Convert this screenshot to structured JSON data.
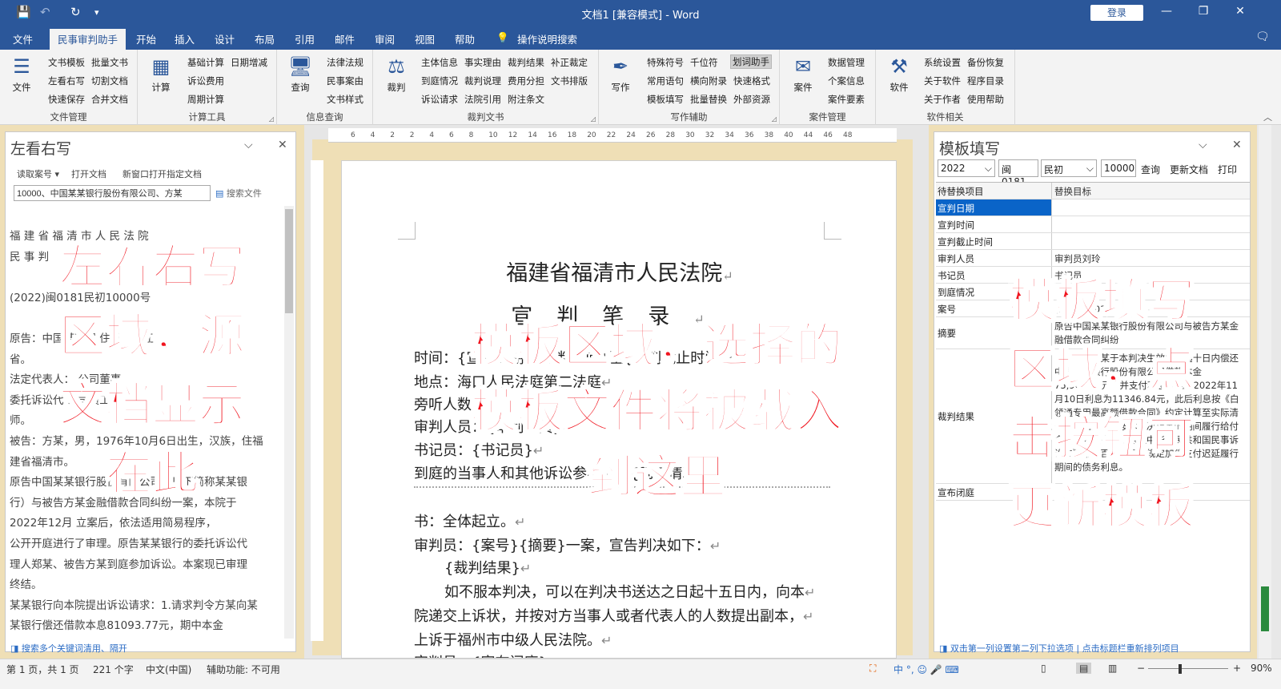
{
  "titlebar": {
    "doc_title": "文档1 [兼容模式] - Word",
    "login": "登录"
  },
  "tabs": [
    "文件",
    "民事审判助手",
    "开始",
    "插入",
    "设计",
    "布局",
    "引用",
    "邮件",
    "审阅",
    "视图",
    "帮助",
    "操作说明搜索"
  ],
  "ribbon": {
    "file": {
      "label": "文件",
      "items": [
        "文书模板",
        "批量文书",
        "左看右写",
        "切割文档",
        "快速保存",
        "合并文档"
      ],
      "group": "文件管理"
    },
    "calc": {
      "label": "计算",
      "items": [
        "基础计算",
        "日期增减",
        "诉讼费用",
        "周期计算"
      ],
      "group": "计算工具"
    },
    "query": {
      "label": "查询",
      "items": [
        "法律法规",
        "民事案由",
        "文书样式"
      ],
      "group": "信息查询"
    },
    "judge": {
      "label": "裁判",
      "items": [
        "主体信息",
        "事实理由",
        "裁判结果",
        "补正裁定",
        "到庭情况",
        "裁判说理",
        "费用分担",
        "文书排版",
        "诉讼请求",
        "法院引用",
        "附注条文"
      ],
      "group": "裁判文书"
    },
    "write": {
      "label": "写作",
      "items": [
        "特殊符号",
        "千位符",
        "划词助手",
        "常用语句",
        "横向附录",
        "快速格式",
        "模板填写",
        "批量替换",
        "外部资源"
      ],
      "group": "写作辅助"
    },
    "case": {
      "label": "案件",
      "items": [
        "数据管理",
        "个案信息",
        "案件要素"
      ],
      "group": "案件管理"
    },
    "soft": {
      "label": "软件",
      "items": [
        "系统设置",
        "备份恢复",
        "关于软件",
        "程序目录",
        "关于作者",
        "使用帮助"
      ],
      "group": "软件相关"
    }
  },
  "left": {
    "title": "左看右写",
    "tools": [
      "读取案号 ▾",
      "打开文档",
      "新窗口打开指定文档"
    ],
    "search_value": "10000、中国某某银行股份有限公司、方某",
    "search_btn": "搜索文件",
    "lines": [
      "福 建 省 福 清 市 人 民 法 院",
      "民 事 判",
      "",
      "(2022)闽0181民初10000号",
      "",
      "原告：中国某某银      住所地浙江",
      "省。",
      "法定代表人：      公司董事",
      "委托诉讼代      公司员工       务所律",
      "师。",
      "被告：方某，男，1976年10月6日出生，汉族，住福",
      "建省福清市。",
      "原告中国某某银行股份有限公司（以下简称某某银",
      "行）与被告方某金融借款合同纠纷一案，本院于",
      "2022年12月      立案后，依法适用简易程序，",
      "公开开庭进行了审理。原告某某银行的委托诉讼代",
      "理人郑某、被告方某到庭参加诉讼。本案现已审理",
      "终结。",
      "某某银行向本院提出诉讼请求：1.请求判令方某向某",
      "某银行偿还借款本息81093.77元，期中本金"
    ],
    "footer": "搜索多个关键词清用、隔开"
  },
  "doc": {
    "ruler": [
      "6",
      "4",
      "2",
      "2",
      "4",
      "6",
      "8",
      "10",
      "12",
      "14",
      "16",
      "18",
      "20",
      "22",
      "24",
      "26",
      "28",
      "30",
      "32",
      "34",
      "36",
      "38",
      "40",
      "44",
      "46",
      "48"
    ],
    "title": "福建省福清市人民法院",
    "subtitle": "宣判笔录",
    "lines": [
      "时间：{宣判日期}{宣判时间}至{宣判截止时间}",
      "地点：海口人民法庭第二法庭",
      "旁听人数：",
      "审判人员：{审判人员}",
      "书记员：{书记员}",
      "到庭的当事人和其他诉讼参与人：{到庭情况}",
      "书：全体起立。",
      "审判员：{案号}{摘要}一案，宣告判决如下：",
      "{裁判结果}",
      "如不服本判决，可以在判决书送达之日起十五日内，向本",
      "院递交上诉状，并按对方当事人或者代表人的人数提出副本，",
      "上诉于福州市中级人民法院。",
      "审判员：{宣布闭庭}"
    ],
    "para_mark": "↵"
  },
  "right": {
    "title": "模板填写",
    "year": "2022",
    "court": "闽0181",
    "type": "民初",
    "number": "10000",
    "buttons": [
      "查询",
      "更新文档",
      "打印"
    ],
    "headers": [
      "待替换项目",
      "替换目标"
    ],
    "rows": [
      {
        "k": "宣判日期",
        "v": ""
      },
      {
        "k": "宣判时间",
        "v": ""
      },
      {
        "k": "宣判截止时间",
        "v": ""
      },
      {
        "k": "审判人员",
        "v": "审判员刘玲"
      },
      {
        "k": "书记员",
        "v": "书记员"
      },
      {
        "k": "到庭情况",
        "v": ""
      },
      {
        "k": "案号",
        "v": "(2022)闽0181民初10000"
      },
      {
        "k": "摘要",
        "v": "原告中国某某银行股份有限公司与被告方某金融借款合同纠纷"
      },
      {
        "k": "裁判结果",
        "v": "一、被告方某于本判决生效之日起十日内偿还中国某某银行股份有限公司借款本金75,965.93元，并支付利息（截至2022年11月10日利息为11346.84元，此后利息按《白领通专用最高额借款合同》约定计算至实际清偿之日止，如未按本判决指定的期间履行给付金钱义务，应当依照《中华人民共和国民事诉讼法》第二百六十条之规定加倍支付迟延履行期间的债务利息。"
      },
      {
        "k": "宣布闭庭",
        "v": ""
      }
    ],
    "footer": "双击第一列设置第二列下拉选项 | 点击标题栏重新排列项目"
  },
  "status": {
    "page": "第 1 页，共 1 页",
    "words": "221 个字",
    "lang": "中文(中国)",
    "access": "辅助功能: 不可用",
    "ime": "中 °, ☺ 🎤 ⌨",
    "zoom": "90%"
  },
  "overlay": {
    "left": "左看右写区域，源文档显示在此",
    "center": "模板区域，选择的模板文件将被载入到这里",
    "right": "模板填写区域，点击按钮可更新模板"
  }
}
